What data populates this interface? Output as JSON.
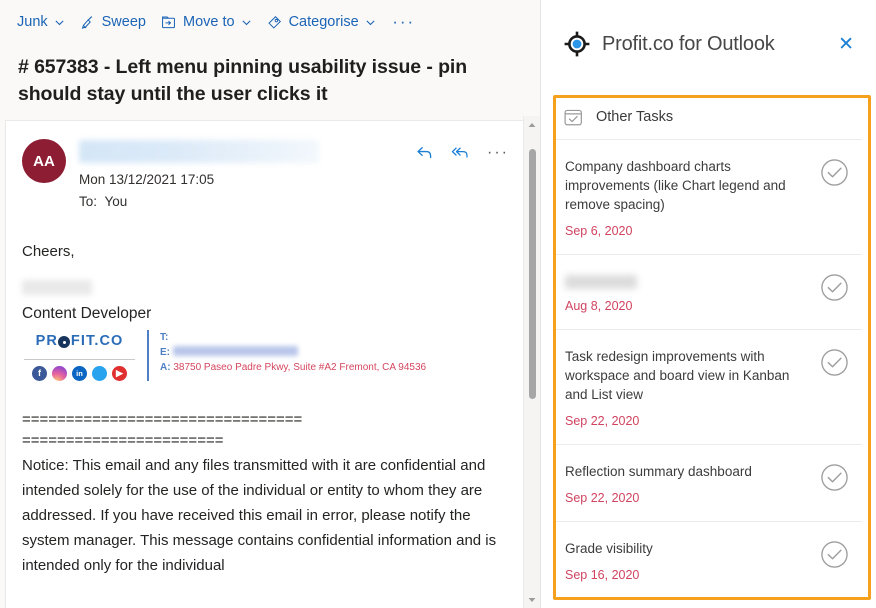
{
  "mail": {
    "toolbar": {
      "junk_label": "Junk",
      "sweep_label": "Sweep",
      "move_to_label": "Move to",
      "categorise_label": "Categorise",
      "more_label": "···"
    },
    "subject": "# 657383 - Left menu pinning usability issue - pin should stay until the user clicks it",
    "message": {
      "avatar_initials": "AA",
      "sender_name": "",
      "date": "Mon 13/12/2021 17:05",
      "to_label": "To:",
      "to_value": "You",
      "actions": {
        "reply": "reply-arrow",
        "reply_all": "reply-all-arrow",
        "more": "···"
      },
      "greeting": "Cheers,",
      "sender_display_name": "",
      "role": "Content Developer",
      "signature": {
        "logo_pre": "PR",
        "logo_post": "FIT.CO",
        "phone_label": "T:",
        "phone_value": "",
        "email_label": "E:",
        "email_value": "",
        "address_label": "A:",
        "address_value": "38750 Paseo Padre Pkwy, Suite #A2 Fremont, CA 94536",
        "socials": [
          "facebook-icon",
          "instagram-icon",
          "linkedin-icon",
          "twitter-icon",
          "youtube-icon"
        ]
      },
      "divider_line_1": "================================",
      "divider_line_2": "=======================",
      "notice": "Notice: This email and any files transmitted with it are confidential and intended solely for the use of the individual or entity to whom they are addressed. If you have received this email in error, please notify the system manager. This message contains confidential information and is intended only for the individual"
    }
  },
  "task_panel": {
    "title": "Profit.co for Outlook",
    "logo": "profit-target-icon",
    "close_label": "✕",
    "section": {
      "label": "Other Tasks",
      "icon": "task-checkbox-icon"
    },
    "highlight_color": "#f5a11d",
    "date_color": "#d1435f",
    "tasks": [
      {
        "title": "Company dashboard charts improvements (like Chart legend and remove spacing)",
        "date": "Sep 6, 2020",
        "redacted": false
      },
      {
        "title": "",
        "date": "Aug 8, 2020",
        "redacted": true
      },
      {
        "title": "Task redesign improvements with workspace and board view in Kanban and List view",
        "date": "Sep 22, 2020",
        "redacted": false
      },
      {
        "title": "Reflection summary dashboard",
        "date": "Sep 22, 2020",
        "redacted": false
      },
      {
        "title": "Grade visibility",
        "date": "Sep 16, 2020",
        "redacted": false
      }
    ]
  }
}
